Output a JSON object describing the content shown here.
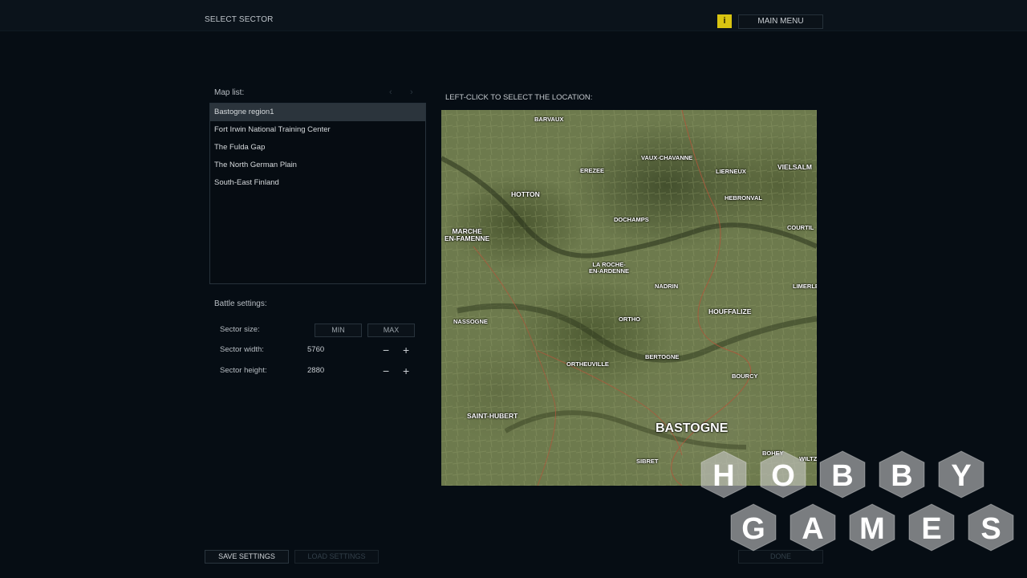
{
  "header": {
    "title": "SELECT SECTOR",
    "info_glyph": "i",
    "main_menu_label": "MAIN MENU"
  },
  "map_list": {
    "label": "Map list:",
    "prev_glyph": "‹",
    "next_glyph": "›",
    "items": [
      {
        "label": "Bastogne region1",
        "selected": true
      },
      {
        "label": "Fort Irwin National Training Center",
        "selected": false
      },
      {
        "label": "The Fulda Gap",
        "selected": false
      },
      {
        "label": "The North German Plain",
        "selected": false
      },
      {
        "label": "South-East Finland",
        "selected": false
      }
    ]
  },
  "battle_settings": {
    "label": "Battle settings:",
    "sector_size_label": "Sector size:",
    "min_label": "MIN",
    "max_label": "MAX",
    "sector_width_label": "Sector width:",
    "sector_width_value": "5760",
    "sector_height_label": "Sector height:",
    "sector_height_value": "2880",
    "minus_glyph": "−",
    "plus_glyph": "+"
  },
  "map_view": {
    "instruction": "LEFT-CLICK TO SELECT THE LOCATION:",
    "towns": [
      {
        "name": "BARVAUX"
      },
      {
        "name": "VAUX-CHAVANNE"
      },
      {
        "name": "EREZEE"
      },
      {
        "name": "LIERNEUX"
      },
      {
        "name": "VIELSALM"
      },
      {
        "name": "HOTTON"
      },
      {
        "name": "HEBRONVAL"
      },
      {
        "name": "DOCHAMPS"
      },
      {
        "name": "COURTIL"
      },
      {
        "name": "MARCHE\nEN-FAMENNE"
      },
      {
        "name": "LA ROCHE-\nEN-ARDENNE"
      },
      {
        "name": "NADRIN"
      },
      {
        "name": "LIMERLE"
      },
      {
        "name": "HOUFFALIZE"
      },
      {
        "name": "NASSOGNE"
      },
      {
        "name": "ORTHO"
      },
      {
        "name": "BERTOGNE"
      },
      {
        "name": "ORTHEUVILLE"
      },
      {
        "name": "BOURCY"
      },
      {
        "name": "SAINT-HUBERT"
      },
      {
        "name": "BASTOGNE"
      },
      {
        "name": "BOHEY"
      },
      {
        "name": "SIBRET"
      },
      {
        "name": "WILTZ"
      }
    ]
  },
  "footer": {
    "save_label": "SAVE SETTINGS",
    "load_label": "LOAD SETTINGS",
    "done_label": "DONE"
  },
  "watermark": {
    "row1": [
      "H",
      "O",
      "B",
      "B",
      "Y"
    ],
    "row2": [
      "G",
      "A",
      "M",
      "E",
      "S"
    ]
  },
  "colors": {
    "background": "#060d14",
    "accent_yellow": "#d9c411",
    "selected_row": "#2b343c"
  }
}
